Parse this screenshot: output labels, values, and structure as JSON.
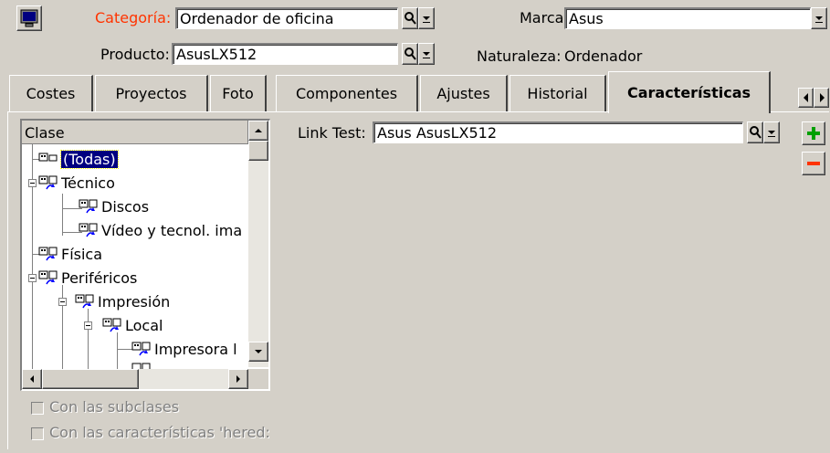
{
  "header": {
    "categoria_label": "Categoría:",
    "categoria_value": "Ordenador de oficina",
    "marca_label": "Marca:",
    "marca_value": "Asus",
    "producto_label": "Producto:",
    "producto_value": "AsusLX512",
    "naturaleza_label": "Naturaleza:",
    "naturaleza_value": "Ordenador"
  },
  "tabs": [
    {
      "label": "Costes"
    },
    {
      "label": "Proyectos"
    },
    {
      "label": "Foto"
    },
    {
      "label": "Componentes"
    },
    {
      "label": "Ajustes"
    },
    {
      "label": "Historial"
    },
    {
      "label": "Características",
      "active": true
    }
  ],
  "tree": {
    "header": "Clase",
    "items": [
      {
        "label": "(Todas)",
        "selected": true
      },
      {
        "label": "Técnico"
      },
      {
        "label": "Discos"
      },
      {
        "label": "Vídeo y tecnol. ima"
      },
      {
        "label": "Física"
      },
      {
        "label": "Periféricos"
      },
      {
        "label": "Impresión"
      },
      {
        "label": "Local"
      },
      {
        "label": "Impresora l"
      }
    ]
  },
  "link_test": {
    "label": "Link Test:",
    "value": "Asus AsusLX512"
  },
  "options": {
    "subclases": "Con las subclases",
    "heredadas": "Con las características 'hered:"
  },
  "colors": {
    "accent_label": "#ff3300",
    "selection": "#000080",
    "window_bg": "#d4d0c8"
  }
}
